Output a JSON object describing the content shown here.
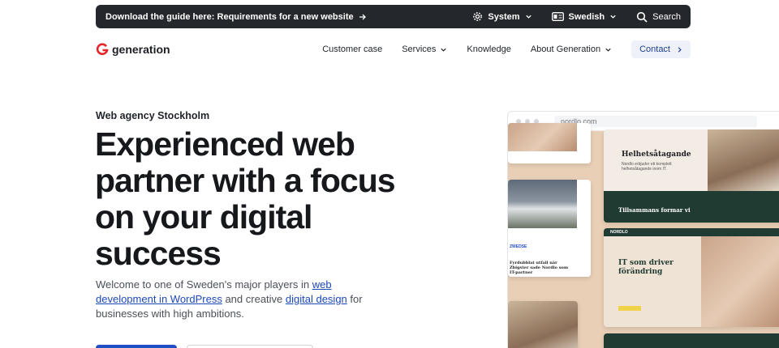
{
  "topbar": {
    "guide_label": "Download the guide here: Requirements for a new website",
    "system_label": "System",
    "language_label": "Swedish",
    "search_label": "Search"
  },
  "logo": {
    "text": "generation",
    "brand_color": "#e4262a"
  },
  "nav": {
    "items": [
      {
        "label": "Customer case",
        "has_dropdown": false
      },
      {
        "label": "Services",
        "has_dropdown": true
      },
      {
        "label": "Knowledge",
        "has_dropdown": false
      },
      {
        "label": "About Generation",
        "has_dropdown": true
      }
    ],
    "contact_label": "Contact"
  },
  "hero": {
    "eyebrow": "Web agency Stockholm",
    "headline": "Experienced web partner with a focus on your digital success",
    "intro_prefix": "Welcome to one of Sweden's major players in ",
    "intro_link1": "web development in WordPress",
    "intro_middle": " and creative ",
    "intro_link2": "digital design",
    "intro_suffix": " for businesses with high ambitions."
  },
  "mockup": {
    "url": "nordlo.com",
    "card1_title": "Helhetsåtagande",
    "card2_band": "Tillsammans formar vi",
    "card3_brand": "NORDLO",
    "card3_title": "IT som driver förändring",
    "news_headline": "Fyrdubblat utfall när Zbigster sade Nordlo som IT-partner"
  },
  "colors": {
    "topbar_bg": "#24272c",
    "link": "#1d48b8",
    "contact_bg": "#eef2f8",
    "primary_button": "#1f4fc7"
  }
}
